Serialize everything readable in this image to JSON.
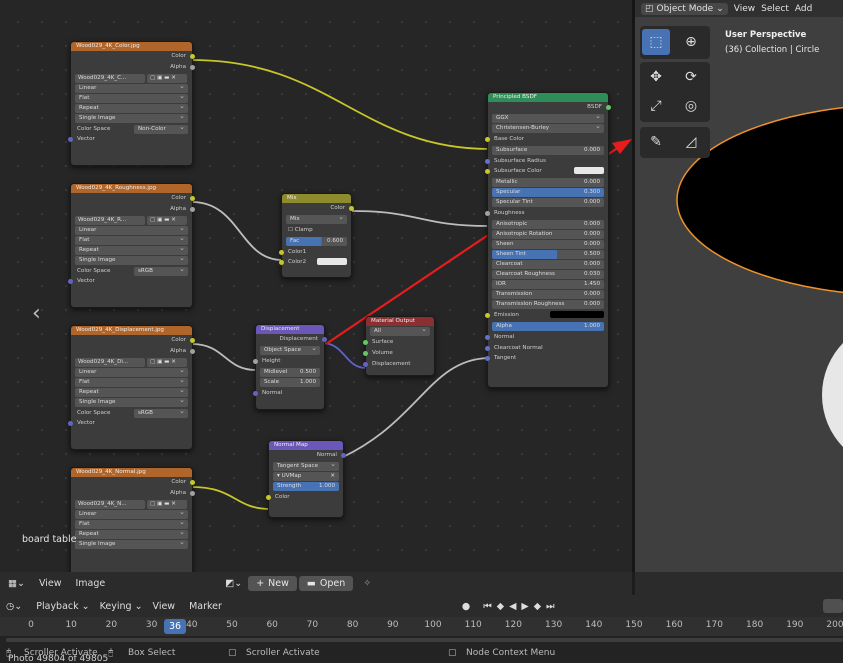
{
  "node_editor": {
    "side_label": "board table",
    "nodes": {
      "color_tex": {
        "title": "Wood029_4K_Color.jpg",
        "out1": "Color",
        "out2": "Alpha",
        "image_name": "Wood029_4K_C...",
        "interp": "Linear",
        "proj": "Flat",
        "ext": "Repeat",
        "source": "Single Image",
        "cs_label": "Color Space",
        "cs_value": "Non-Color",
        "vector": "Vector"
      },
      "rough_tex": {
        "title": "Wood029_4K_Roughness.jpg",
        "out1": "Color",
        "out2": "Alpha",
        "image_name": "Wood029_4K_R...",
        "interp": "Linear",
        "proj": "Flat",
        "ext": "Repeat",
        "source": "Single Image",
        "cs_label": "Color Space",
        "cs_value": "sRGB",
        "vector": "Vector"
      },
      "disp_tex": {
        "title": "Wood029_4K_Displacement.jpg",
        "out1": "Color",
        "out2": "Alpha",
        "image_name": "Wood029_4K_Di...",
        "interp": "Linear",
        "proj": "Flat",
        "ext": "Repeat",
        "source": "Single Image",
        "cs_label": "Color Space",
        "cs_value": "sRGB",
        "vector": "Vector"
      },
      "normal_tex": {
        "title": "Wood029_4K_Normal.jpg",
        "out1": "Color",
        "out2": "Alpha",
        "image_name": "Wood029_4K_N...",
        "interp": "Linear",
        "proj": "Flat",
        "ext": "Repeat",
        "source": "Single Image"
      },
      "mix": {
        "title": "Mix",
        "out": "Color",
        "blend": "Mix",
        "clamp": "Clamp",
        "fac_label": "Fac",
        "fac_value": "0.600",
        "color1": "Color1",
        "color2": "Color2"
      },
      "displacement": {
        "title": "Displacement",
        "out": "Displacement",
        "space": "Object Space",
        "height": "Height",
        "midlevel_label": "Midlevel",
        "midlevel_value": "0.500",
        "scale_label": "Scale",
        "scale_value": "1.000",
        "normal": "Normal"
      },
      "normal_map": {
        "title": "Normal Map",
        "out": "Normal",
        "space": "Tangent Space",
        "uv": "UVMap",
        "strength_label": "Strength",
        "strength_value": "1.000",
        "color": "Color"
      },
      "material_output": {
        "title": "Material Output",
        "target": "All",
        "surface": "Surface",
        "volume": "Volume",
        "displacement": "Displacement"
      },
      "bsdf": {
        "title": "Principled BSDF",
        "out": "BSDF",
        "distribution": "GGX",
        "subsurface_method": "Christensen-Burley",
        "base_color": "Base Color",
        "rows": [
          {
            "label": "Subsurface",
            "value": "0.000"
          },
          {
            "label": "Subsurface Radius",
            "value": ""
          },
          {
            "label": "Subsurface Color",
            "value": ""
          },
          {
            "label": "Metallic",
            "value": "0.000"
          },
          {
            "label": "Specular",
            "value": "0.300"
          },
          {
            "label": "Specular Tint",
            "value": "0.000"
          },
          {
            "label": "Roughness",
            "value": ""
          },
          {
            "label": "Anisotropic",
            "value": "0.000"
          },
          {
            "label": "Anisotropic Rotation",
            "value": "0.000"
          },
          {
            "label": "Sheen",
            "value": "0.000"
          },
          {
            "label": "Sheen Tint",
            "value": "0.500"
          },
          {
            "label": "Clearcoat",
            "value": "0.000"
          },
          {
            "label": "Clearcoat Roughness",
            "value": "0.030"
          },
          {
            "label": "IOR",
            "value": "1.450"
          },
          {
            "label": "Transmission",
            "value": "0.000"
          },
          {
            "label": "Transmission Roughness",
            "value": "0.000"
          },
          {
            "label": "Emission",
            "value": ""
          },
          {
            "label": "Alpha",
            "value": "1.000"
          },
          {
            "label": "Normal",
            "value": ""
          },
          {
            "label": "Clearcoat Normal",
            "value": ""
          },
          {
            "label": "Tangent",
            "value": ""
          }
        ]
      }
    }
  },
  "viewport": {
    "mode": "Object Mode",
    "menu": [
      "View",
      "Select",
      "Add"
    ],
    "title": "User Perspective",
    "subtitle": "(36) Collection | Circle"
  },
  "image_editor": {
    "menu_view": "View",
    "menu_image": "Image",
    "new_label": "New",
    "open_label": "Open"
  },
  "timeline": {
    "menus": [
      "Playback",
      "Keying",
      "View",
      "Marker"
    ],
    "current_frame": "36",
    "ticks": [
      "0",
      "10",
      "20",
      "30",
      "40",
      "50",
      "60",
      "70",
      "80",
      "90",
      "100",
      "110",
      "120",
      "130",
      "140",
      "150",
      "160",
      "170",
      "180",
      "190",
      "200"
    ]
  },
  "statusbar": {
    "left": "Scroller Activate",
    "box": "Box Select",
    "mid": "Scroller Activate",
    "right": "Node Context Menu"
  },
  "caption": "Photo 49804 of 49805"
}
